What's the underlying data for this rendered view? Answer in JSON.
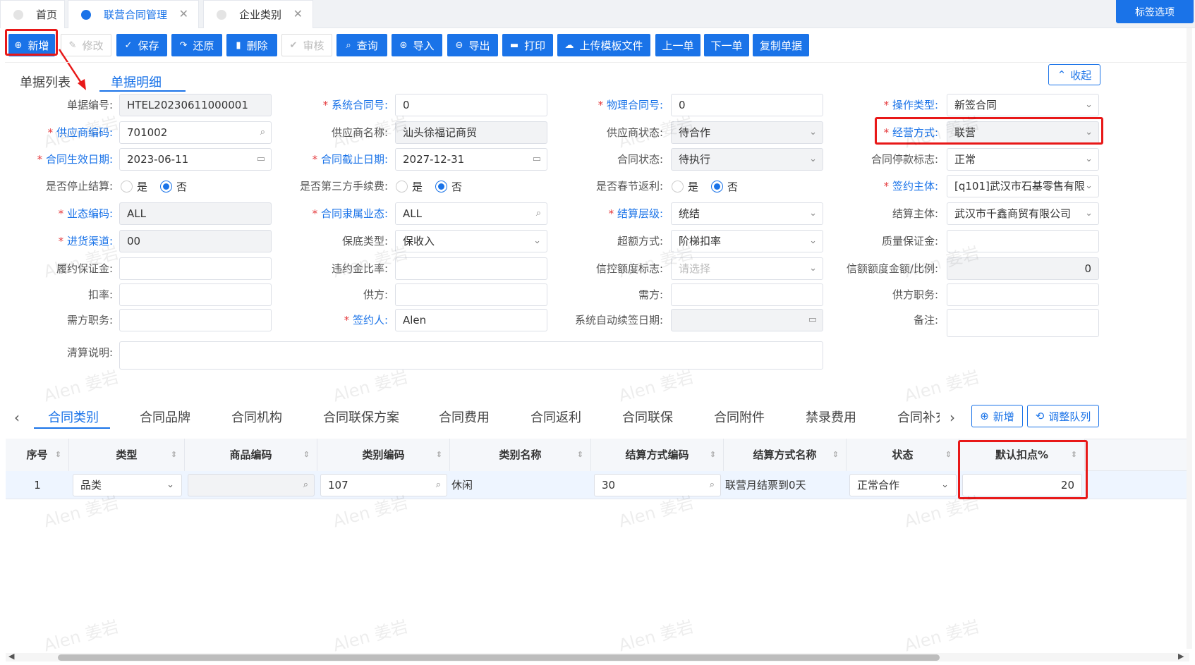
{
  "page_tabs": [
    {
      "label": "首页"
    },
    {
      "label": "联营合同管理"
    },
    {
      "label": "企业类别"
    }
  ],
  "tag_options": "标签选项",
  "toolbar": [
    "新增",
    "修改",
    "保存",
    "还原",
    "删除",
    "审核",
    "查询",
    "导入",
    "导出",
    "打印",
    "上传模板文件",
    "上一单",
    "下一单",
    "复制单据"
  ],
  "detail_tabs": [
    "单据列表",
    "单据明细"
  ],
  "collapse": "收起",
  "form": {
    "doc_no": {
      "label": "单据编号:",
      "value": "HTEL20230611000001"
    },
    "sys_contract": {
      "label": "系统合同号:",
      "value": "0"
    },
    "phys_contract": {
      "label": "物理合同号:",
      "value": "0"
    },
    "op_type": {
      "label": "操作类型:",
      "value": "新签合同"
    },
    "supplier_code": {
      "label": "供应商编码:",
      "value": "701002"
    },
    "supplier_name": {
      "label": "供应商名称:",
      "value": "汕头徐福记商贸"
    },
    "supplier_status": {
      "label": "供应商状态:",
      "value": "待合作"
    },
    "biz_mode": {
      "label": "经营方式:",
      "value": "联营"
    },
    "start_date": {
      "label": "合同生效日期:",
      "value": "2023-06-11"
    },
    "end_date": {
      "label": "合同截止日期:",
      "value": "2027-12-31"
    },
    "contract_status": {
      "label": "合同状态:",
      "value": "待执行"
    },
    "pay_stop_flag": {
      "label": "合同停款标志:",
      "value": "正常"
    },
    "stop_settle": {
      "label": "是否停止结算:",
      "yes": "是",
      "no": "否"
    },
    "third_fee": {
      "label": "是否第三方手续费:",
      "yes": "是",
      "no": "否"
    },
    "festival_rebate": {
      "label": "是否春节返利:",
      "yes": "是",
      "no": "否"
    },
    "sign_entity": {
      "label": "签约主体:",
      "value": "[q101]武汉市石基零售有限"
    },
    "format_code": {
      "label": "业态编码:",
      "value": "ALL"
    },
    "belong_format": {
      "label": "合同隶属业态:",
      "value": "ALL"
    },
    "settle_level": {
      "label": "结算层级:",
      "value": "统结"
    },
    "settle_entity": {
      "label": "结算主体:",
      "value": "武汉市千鑫商贸有限公司"
    },
    "channel": {
      "label": "进货渠道:",
      "value": "00"
    },
    "guarantee_type": {
      "label": "保底类型:",
      "value": "保收入"
    },
    "overflow_mode": {
      "label": "超额方式:",
      "value": "阶梯扣率"
    },
    "quality_deposit": {
      "label": "质量保证金:",
      "value": ""
    },
    "perf_deposit": {
      "label": "履约保证金:",
      "value": ""
    },
    "penalty_ratio": {
      "label": "违约金比率:",
      "value": ""
    },
    "credit_flag": {
      "label": "信控额度标志:",
      "placeholder": "请选择"
    },
    "credit_amount": {
      "label": "信额额度金额/比例:",
      "value": "0"
    },
    "rate": {
      "label": "扣率:",
      "value": ""
    },
    "supplier_party": {
      "label": "供方:",
      "value": ""
    },
    "demand_party": {
      "label": "需方:",
      "value": ""
    },
    "supplier_duty": {
      "label": "供方职务:",
      "value": ""
    },
    "demand_duty": {
      "label": "需方职务:",
      "value": ""
    },
    "signer": {
      "label": "签约人:",
      "value": "Alen"
    },
    "auto_renew": {
      "label": "系统自动续签日期:",
      "value": ""
    },
    "remark": {
      "label": "备注:",
      "value": ""
    },
    "settle_note": {
      "label": "清算说明:",
      "value": ""
    }
  },
  "sub_tabs": [
    "合同类别",
    "合同品牌",
    "合同机构",
    "合同联保方案",
    "合同费用",
    "合同返利",
    "合同联保",
    "合同附件",
    "禁录费用",
    "合同补充"
  ],
  "sub_buttons": [
    "新增",
    "调整队列"
  ],
  "table": {
    "headers": [
      "序号",
      "类型",
      "商品编码",
      "类别编码",
      "类别名称",
      "结算方式编码",
      "结算方式名称",
      "状态",
      "默认扣点%"
    ],
    "rows": [
      [
        "1",
        "品类",
        "",
        "107",
        "休闲",
        "30",
        "联营月结票到0天",
        "正常合作",
        "20"
      ]
    ]
  },
  "watermark": "Alen 姜岩"
}
